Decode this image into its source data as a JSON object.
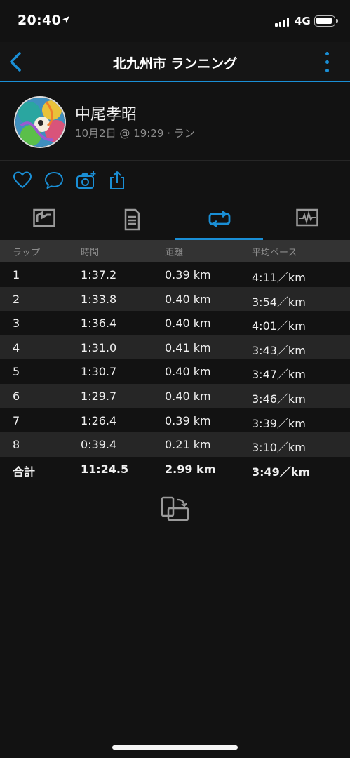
{
  "status_bar": {
    "time": "20:40",
    "network": "4G"
  },
  "nav": {
    "title": "北九州市 ランニング"
  },
  "profile": {
    "name": "中尾孝昭",
    "meta": "10月2日 @ 19:29 · ラン"
  },
  "icons": {
    "back": "chevron-left-icon",
    "more": "more-vertical-icon",
    "like": "heart-icon",
    "comment": "comment-icon",
    "photo": "camera-plus-icon",
    "share": "share-icon",
    "tabs": [
      "chart-summary-icon",
      "document-list-icon",
      "laps-loop-icon",
      "graph-monitor-icon"
    ],
    "rotate": "rotate-device-icon"
  },
  "colors": {
    "accent": "#1a8fd6",
    "background": "#121212",
    "row_alt": "#262626",
    "header_bg": "#333333"
  },
  "laps_table": {
    "headers": [
      "ラップ",
      "時間",
      "距離",
      "平均ペース"
    ],
    "rows": [
      [
        "1",
        "1:37.2",
        "0.39 km",
        "4:11／km"
      ],
      [
        "2",
        "1:33.8",
        "0.40 km",
        "3:54／km"
      ],
      [
        "3",
        "1:36.4",
        "0.40 km",
        "4:01／km"
      ],
      [
        "4",
        "1:31.0",
        "0.41 km",
        "3:43／km"
      ],
      [
        "5",
        "1:30.7",
        "0.40 km",
        "3:47／km"
      ],
      [
        "6",
        "1:29.7",
        "0.40 km",
        "3:46／km"
      ],
      [
        "7",
        "1:26.4",
        "0.39 km",
        "3:39／km"
      ],
      [
        "8",
        "0:39.4",
        "0.21 km",
        "3:10／km"
      ]
    ],
    "total": [
      "合計",
      "11:24.5",
      "2.99 km",
      "3:49／km"
    ]
  }
}
